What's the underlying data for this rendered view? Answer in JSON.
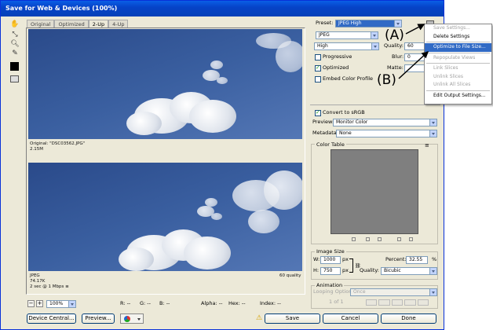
{
  "window": {
    "title": "Save for Web & Devices (100%)"
  },
  "view_tabs": [
    "Original",
    "Optimized",
    "2-Up",
    "4-Up"
  ],
  "top_pane": {
    "lines": [
      "Original: \"DSC03562.JPG\"",
      "2.15M"
    ]
  },
  "bottom_pane": {
    "left_lines": [
      "JPEG",
      "74.17K",
      "2 sec @ 1 Mbps"
    ],
    "right": "60 quality",
    "menu_glyph": "≡"
  },
  "status": {
    "zoom": "100%",
    "r": "R: --",
    "g": "G: --",
    "b": "B: --",
    "alpha": "Alpha: --",
    "hex": "Hex: --",
    "index": "Index: --"
  },
  "settings": {
    "preset_label": "Preset:",
    "preset_value": "JPEG High",
    "format": "JPEG",
    "quality_level": "High",
    "quality_label": "Quality:",
    "quality_value": "60",
    "blur_label": "Blur:",
    "blur_value": "0",
    "matte_label": "Matte:",
    "progressive": "Progressive",
    "optimized": "Optimized",
    "embed_profile": "Embed Color Profile",
    "convert_srgb": "Convert to sRGB",
    "preview_label": "Preview:",
    "preview_value": "Monitor Color",
    "metadata_label": "Metadata:",
    "metadata_value": "None"
  },
  "color_table": {
    "title": "Color Table"
  },
  "image_size": {
    "title": "Image Size",
    "w_label": "W:",
    "w_value": "1000",
    "w_unit": "px",
    "h_label": "H:",
    "h_value": "750",
    "h_unit": "px",
    "percent_label": "Percent:",
    "percent_value": "32.55",
    "percent_unit": "%",
    "quality_label": "Quality:",
    "quality_value": "Bicubic"
  },
  "animation": {
    "title": "Animation",
    "looping_label": "Looping Options:",
    "looping_value": "Once",
    "frame": "1 of 1"
  },
  "menu": {
    "items": [
      {
        "label": "Save Settings...",
        "state": "disabled"
      },
      {
        "label": "Delete Settings",
        "state": "normal"
      },
      {
        "label": "Optimize to File Size...",
        "state": "highlight"
      },
      {
        "label": "Repopulate Views",
        "state": "disabled"
      },
      {
        "label": "Link Slices",
        "state": "disabled"
      },
      {
        "label": "Unlink Slices",
        "state": "disabled"
      },
      {
        "label": "Unlink All Slices",
        "state": "disabled"
      },
      {
        "label": "Edit Output Settings...",
        "state": "normal"
      }
    ]
  },
  "annotations": {
    "a": "(A)",
    "b": "(B)"
  },
  "buttons": {
    "device_central": "Device Central...",
    "preview": "Preview...",
    "save": "Save",
    "cancel": "Cancel",
    "done": "Done"
  }
}
